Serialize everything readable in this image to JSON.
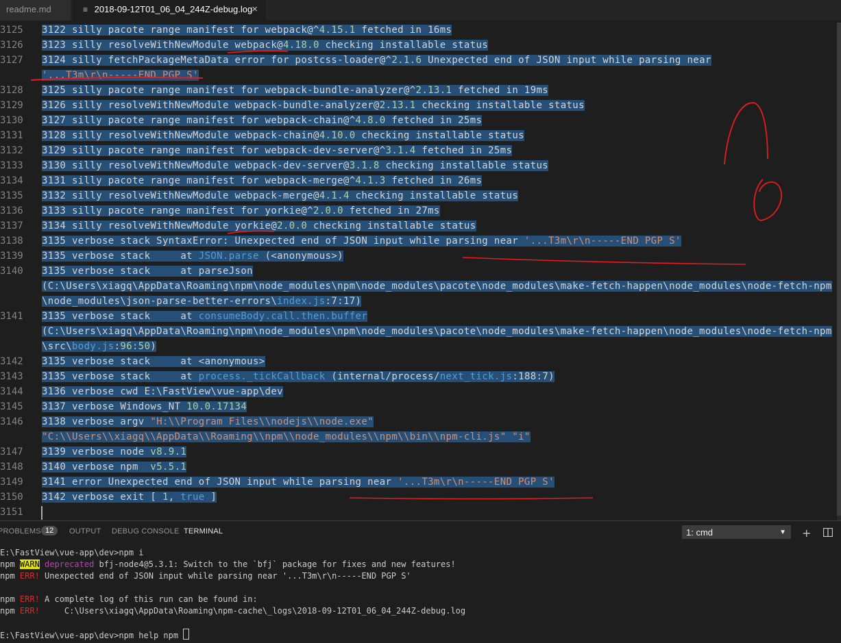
{
  "tabs": [
    {
      "label": "readme.md"
    },
    {
      "label": "2018-09-12T01_06_04_244Z-debug.log",
      "close": "×"
    }
  ],
  "editor": {
    "lines": [
      {
        "n": "3125",
        "segs": [
          [
            "3122 silly pacote range manifest for webpack@^",
            ""
          ],
          [
            "4.15.1",
            "n"
          ],
          [
            " fetched in 16ms",
            ""
          ]
        ]
      },
      {
        "n": "3126",
        "segs": [
          [
            "3123 silly resolveWithNewModule webpack@",
            ""
          ],
          [
            "4.18.0",
            "n"
          ],
          [
            " checking installable status",
            ""
          ]
        ]
      },
      {
        "n": "3127",
        "segs": [
          [
            "3124 silly fetchPackageMetaData error for postcss-loader@^",
            ""
          ],
          [
            "2.1.6",
            "n"
          ],
          [
            " Unexpected end of JSON input while parsing near",
            ""
          ]
        ]
      },
      {
        "n": "",
        "segs": [
          [
            "'...T3m\\r\\n-----END PGP S'",
            "s"
          ]
        ]
      },
      {
        "n": "3128",
        "segs": [
          [
            "3125 silly pacote range manifest for webpack-bundle-analyzer@^",
            ""
          ],
          [
            "2.13.1",
            "n"
          ],
          [
            " fetched in 19ms",
            ""
          ]
        ]
      },
      {
        "n": "3129",
        "segs": [
          [
            "3126 silly resolveWithNewModule webpack-bundle-analyzer@",
            ""
          ],
          [
            "2.13.1",
            "n"
          ],
          [
            " checking installable status",
            ""
          ]
        ]
      },
      {
        "n": "3130",
        "segs": [
          [
            "3127 silly pacote range manifest for webpack-chain@^",
            ""
          ],
          [
            "4.8.0",
            "n"
          ],
          [
            " fetched in 25ms",
            ""
          ]
        ]
      },
      {
        "n": "3131",
        "segs": [
          [
            "3128 silly resolveWithNewModule webpack-chain@",
            ""
          ],
          [
            "4.10.0",
            "n"
          ],
          [
            " checking installable status",
            ""
          ]
        ]
      },
      {
        "n": "3132",
        "segs": [
          [
            "3129 silly pacote range manifest for webpack-dev-server@^",
            ""
          ],
          [
            "3.1.4",
            "n"
          ],
          [
            " fetched in 25ms",
            ""
          ]
        ]
      },
      {
        "n": "3133",
        "segs": [
          [
            "3130 silly resolveWithNewModule webpack-dev-server@",
            ""
          ],
          [
            "3.1.8",
            "n"
          ],
          [
            " checking installable status",
            ""
          ]
        ]
      },
      {
        "n": "3134",
        "segs": [
          [
            "3131 silly pacote range manifest for webpack-merge@^",
            ""
          ],
          [
            "4.1.3",
            "n"
          ],
          [
            " fetched in 26ms",
            ""
          ]
        ]
      },
      {
        "n": "3135",
        "segs": [
          [
            "3132 silly resolveWithNewModule webpack-merge@",
            ""
          ],
          [
            "4.1.4",
            "n"
          ],
          [
            " checking installable status",
            ""
          ]
        ]
      },
      {
        "n": "3136",
        "segs": [
          [
            "3133 silly pacote range manifest for yorkie@^",
            ""
          ],
          [
            "2.0.0",
            "n"
          ],
          [
            " fetched in 27ms",
            ""
          ]
        ]
      },
      {
        "n": "3137",
        "segs": [
          [
            "3134 silly resolveWithNewModule yorkie@",
            ""
          ],
          [
            "2.0.0",
            "n"
          ],
          [
            " checking installable status",
            ""
          ]
        ]
      },
      {
        "n": "3138",
        "segs": [
          [
            "3135 verbose stack SyntaxError: Unexpected end of JSON input while parsing near ",
            ""
          ],
          [
            "'...T3m\\r\\n-----END PGP S'",
            "s"
          ]
        ]
      },
      {
        "n": "3139",
        "segs": [
          [
            "3135 verbose stack     at ",
            ""
          ],
          [
            "JSON.parse",
            "f"
          ],
          [
            " (<anonymous>)",
            ""
          ]
        ]
      },
      {
        "n": "3140",
        "segs": [
          [
            "3135 verbose stack     at parseJson",
            ""
          ]
        ]
      },
      {
        "n": "",
        "segs": [
          [
            "(C:\\Users\\xiagq\\AppData\\Roaming\\npm\\node_modules\\npm\\node_modules\\pacote\\node_modules\\make-fetch-happen\\node_modules\\node-fetch-npm",
            ""
          ]
        ]
      },
      {
        "n": "",
        "segs": [
          [
            "\\node_modules\\json-parse-better-errors\\",
            ""
          ],
          [
            "index.js",
            "f"
          ],
          [
            ":7:17)",
            ""
          ]
        ]
      },
      {
        "n": "3141",
        "segs": [
          [
            "3135 verbose stack     at ",
            ""
          ],
          [
            "consumeBody.call.then.buffer",
            "f"
          ]
        ]
      },
      {
        "n": "",
        "segs": [
          [
            "(C:\\Users\\xiagq\\AppData\\Roaming\\npm\\node_modules\\npm\\node_modules\\pacote\\node_modules\\make-fetch-happen\\node_modules\\node-fetch-npm",
            ""
          ]
        ]
      },
      {
        "n": "",
        "segs": [
          [
            "\\src\\",
            ""
          ],
          [
            "body.js",
            "f"
          ],
          [
            ":",
            ""
          ],
          [
            "96:50",
            "n"
          ],
          [
            ")",
            ""
          ]
        ]
      },
      {
        "n": "3142",
        "segs": [
          [
            "3135 verbose stack     at <anonymous>",
            ""
          ]
        ]
      },
      {
        "n": "3143",
        "segs": [
          [
            "3135 verbose stack     at ",
            ""
          ],
          [
            "process._tickCallback",
            "f"
          ],
          [
            " (internal/process/",
            ""
          ],
          [
            "next_tick.js",
            "f"
          ],
          [
            ":188:7)",
            ""
          ]
        ]
      },
      {
        "n": "3144",
        "segs": [
          [
            "3136 verbose cwd E:\\FastView\\vue-app\\dev",
            ""
          ]
        ]
      },
      {
        "n": "3145",
        "segs": [
          [
            "3137 verbose Windows_NT ",
            ""
          ],
          [
            "10.0.17134",
            "n"
          ]
        ]
      },
      {
        "n": "3146",
        "segs": [
          [
            "3138 verbose argv ",
            ""
          ],
          [
            "\"H:\\\\Program Files\\\\nodejs\\\\node.exe\"",
            "s"
          ]
        ]
      },
      {
        "n": "",
        "segs": [
          [
            "\"C:\\\\Users\\\\xiagq\\\\AppData\\\\Roaming\\\\npm\\\\node_modules\\\\npm\\\\bin\\\\npm-cli.js\"",
            "s"
          ],
          [
            " ",
            ""
          ],
          [
            "\"i\"",
            "s"
          ]
        ]
      },
      {
        "n": "3147",
        "segs": [
          [
            "3139 verbose node ",
            ""
          ],
          [
            "v8.9.1",
            "n"
          ]
        ]
      },
      {
        "n": "3148",
        "segs": [
          [
            "3140 verbose npm  ",
            ""
          ],
          [
            "v5.5.1",
            "n"
          ]
        ]
      },
      {
        "n": "3149",
        "segs": [
          [
            "3141 error Unexpected end of JSON input while parsing near ",
            ""
          ],
          [
            "'...T3m\\r\\n-----END PGP S'",
            "s"
          ]
        ]
      },
      {
        "n": "3150",
        "segs": [
          [
            "3142 verbose exit [ ",
            ""
          ],
          [
            "1",
            "n"
          ],
          [
            ", ",
            ""
          ],
          [
            "true",
            "f"
          ],
          [
            " ]",
            ""
          ]
        ]
      },
      {
        "n": "3151",
        "segs": []
      }
    ]
  },
  "panel": {
    "tabs": [
      "PROBLEMS",
      "OUTPUT",
      "DEBUG CONSOLE",
      "TERMINAL"
    ],
    "problems_count": "12",
    "terminal_select": "1: cmd",
    "add_icon": "plus-icon",
    "split_icon": "split-icon"
  },
  "terminal": {
    "lines": [
      [
        [
          "E:\\FastView\\vue-app\\dev>npm i",
          ""
        ]
      ],
      [
        [
          "npm ",
          ""
        ],
        [
          "WARN",
          "warn"
        ],
        [
          " ",
          ""
        ],
        [
          "deprecated",
          "mag"
        ],
        [
          " bfj-node4@5.3.1: Switch to the `bfj` package for fixes and new features!",
          ""
        ]
      ],
      [
        [
          "npm ",
          ""
        ],
        [
          "ERR!",
          "err"
        ],
        [
          " Unexpected end of JSON input while parsing near '...T3m\\r\\n-----END PGP S'",
          ""
        ]
      ],
      [],
      [
        [
          "npm ",
          ""
        ],
        [
          "ERR!",
          "err"
        ],
        [
          " A complete log of this run can be found in:",
          ""
        ]
      ],
      [
        [
          "npm ",
          ""
        ],
        [
          "ERR!",
          "err"
        ],
        [
          "     C:\\Users\\xiagq\\AppData\\Roaming\\npm-cache\\_logs\\2018-09-12T01_06_04_244Z-debug.log",
          ""
        ]
      ],
      [],
      [
        [
          "E:\\FastView\\vue-app\\dev>npm help npm ",
          ""
        ]
      ]
    ]
  },
  "colors": {
    "selection": "#264f78",
    "annotation": "#e51c1c"
  }
}
